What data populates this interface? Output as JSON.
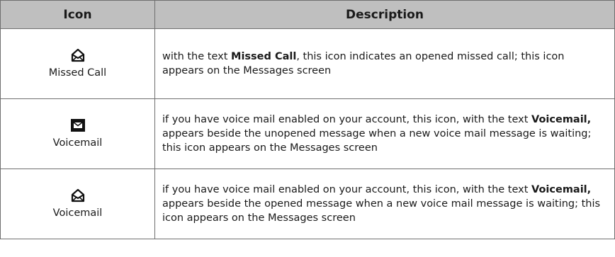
{
  "table": {
    "headers": {
      "icon": "Icon",
      "description": "Description"
    },
    "rows": [
      {
        "icon_name": "envelope-opened-icon",
        "icon_label": "Missed Call",
        "desc_before": "with the text ",
        "desc_bold": "Missed Call",
        "desc_after": ", this icon indicates an opened missed call; this icon appears on the Messages screen"
      },
      {
        "icon_name": "envelope-unopened-icon",
        "icon_label": "Voicemail",
        "desc_before": "if you have voice mail enabled on your account, this icon, with the text ",
        "desc_bold": "Voicemail,",
        "desc_after": " appears beside the unopened message when a new voice mail message is waiting; this icon appears on the Messages screen"
      },
      {
        "icon_name": "envelope-opened-icon",
        "icon_label": "Voicemail",
        "desc_before": "if you have voice mail enabled on your account, this icon, with the text ",
        "desc_bold": "Voicemail,",
        "desc_after": " appears beside the opened message when a new voice mail message is waiting; this icon appears on the Messages screen"
      }
    ]
  }
}
